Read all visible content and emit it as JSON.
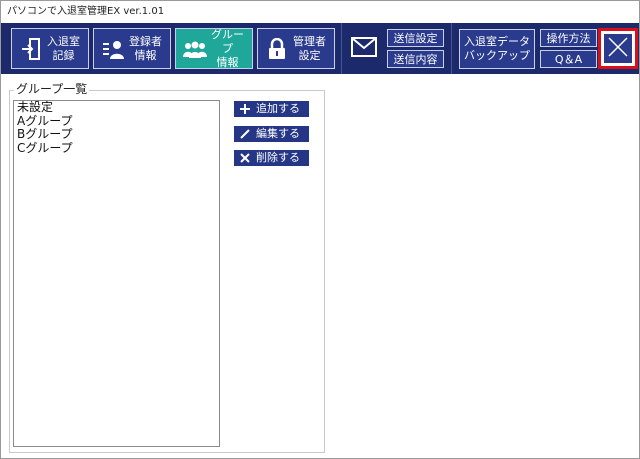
{
  "window": {
    "title": "パソコンで入退室管理EX ver.1.01"
  },
  "toolbar": {
    "nav": [
      {
        "label": "入退室\n記録",
        "icon": "door-enter-icon"
      },
      {
        "label": "登録者\n情報",
        "icon": "user-list-icon"
      },
      {
        "label": "グループ\n情報",
        "icon": "group-users-icon",
        "active": true
      },
      {
        "label": "管理者\n設定",
        "icon": "lock-icon"
      }
    ],
    "mail": {
      "icon": "envelope-icon",
      "send_settings": "送信設定",
      "send_content": "送信内容"
    },
    "backup_label": "入退室データ\nバックアップ",
    "help": {
      "manual": "操作方法",
      "faq": "Q＆A"
    },
    "close_icon": "close-x-icon"
  },
  "groups": {
    "legend": "グループ一覧",
    "items": [
      "未設定",
      "Aグループ",
      "Bグループ",
      "Cグループ"
    ],
    "actions": {
      "add": "追加する",
      "edit": "編集する",
      "delete": "削除する"
    }
  },
  "colors": {
    "toolbar_bg": "#1c2a6b",
    "button_bg": "#2a3a8c",
    "active_bg": "#1fa79a",
    "close_highlight": "#d8101a"
  }
}
